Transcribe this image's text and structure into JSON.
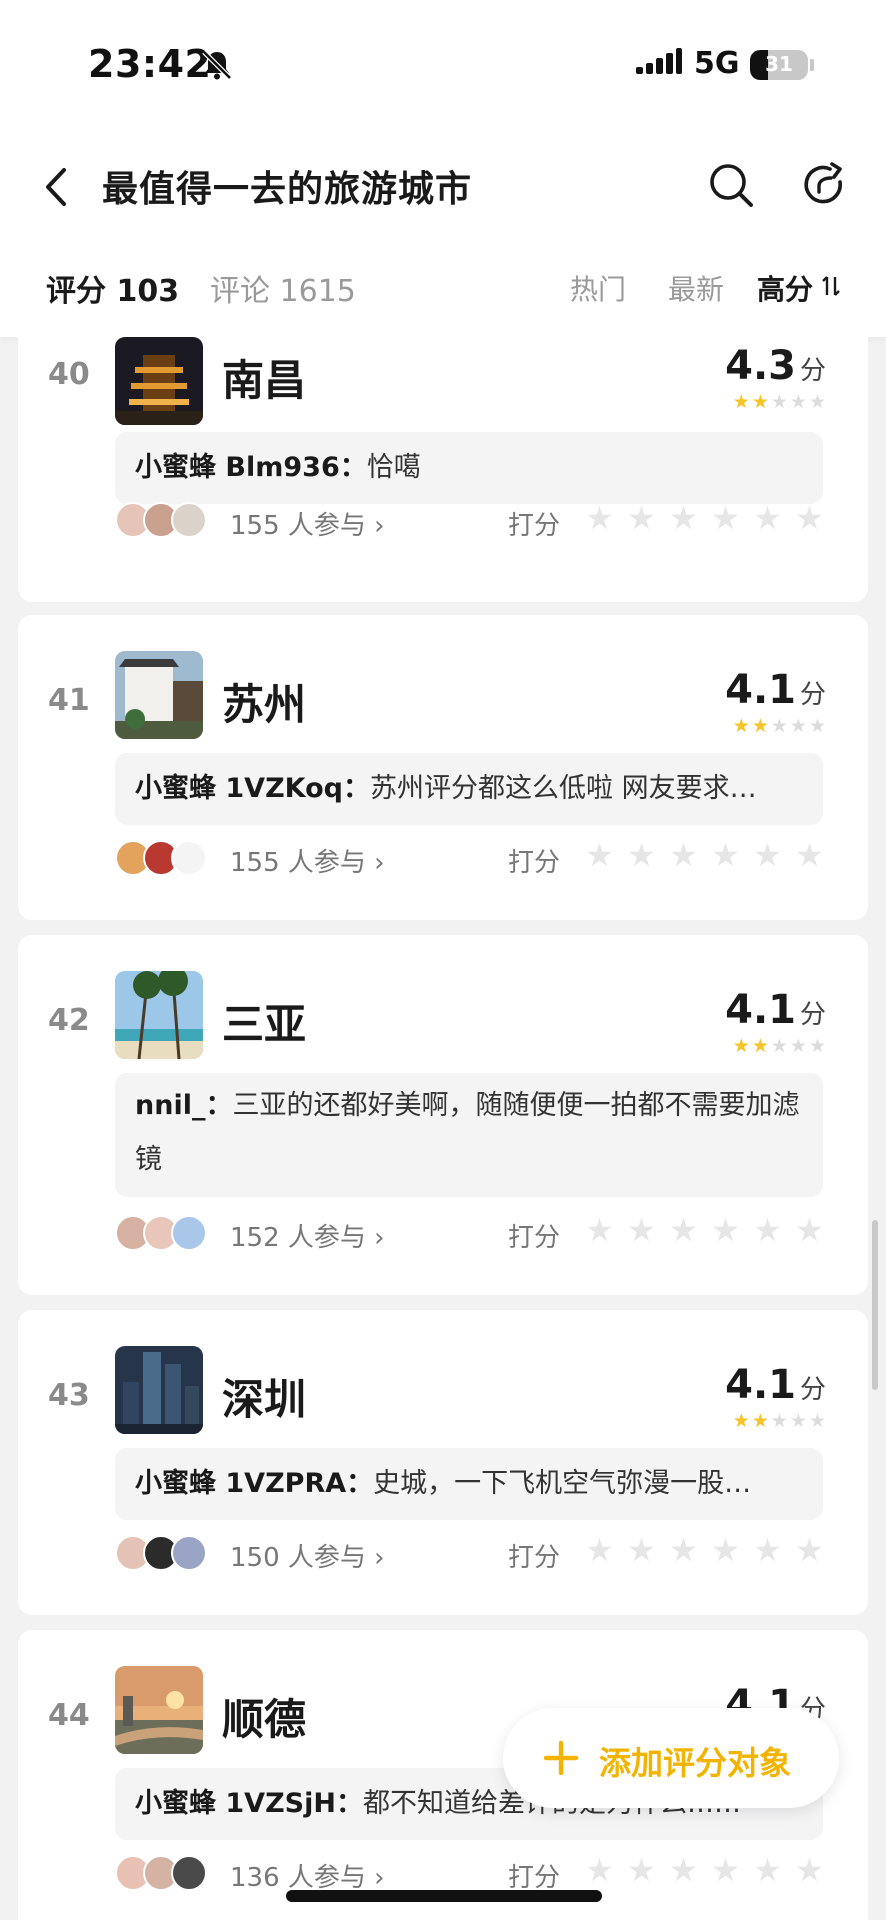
{
  "status_bar": {
    "time": "23:42",
    "network": "5G",
    "battery": "31",
    "battery_level_percent": 31
  },
  "header": {
    "title": "最值得一去的旅游城市",
    "icons": [
      "back-icon",
      "search-icon",
      "share-icon"
    ]
  },
  "tabs": {
    "ratings": "评分 103",
    "comments": "评论 1615"
  },
  "sort": {
    "hot": "热门",
    "new": "最新",
    "high": "高分",
    "active": "高分"
  },
  "common": {
    "score_unit": "分",
    "rate_label": "打分"
  },
  "colors": {
    "star_active": "#f6c427",
    "fab_text": "#f2b400",
    "card_bg": "#ffffff",
    "page_bg": "#f2f2f3"
  },
  "items": [
    {
      "rank": "40",
      "name": "南昌",
      "score": "4.3",
      "stars_filled": 2,
      "user": "小蜜蜂 Blm936：",
      "text": "恰噶",
      "participants": "155 人参与"
    },
    {
      "rank": "41",
      "name": "苏州",
      "score": "4.1",
      "stars_filled": 2,
      "user": "小蜜蜂 1VZKoq：",
      "text": "苏州评分都这么低啦 网友要求…",
      "participants": "155 人参与"
    },
    {
      "rank": "42",
      "name": "三亚",
      "score": "4.1",
      "stars_filled": 2,
      "user": "nnil_：",
      "text": "三亚的还都好美啊，随随便便一拍都不需要加滤镜",
      "participants": "152 人参与"
    },
    {
      "rank": "43",
      "name": "深圳",
      "score": "4.1",
      "stars_filled": 2,
      "user": "小蜜蜂 1VZPRA：",
      "text": "史城，一下飞机空气弥漫一股…",
      "participants": "150 人参与"
    },
    {
      "rank": "44",
      "name": "顺德",
      "score": "4.1",
      "stars_filled": 2,
      "user": "小蜜蜂 1VZSjH：",
      "text": "都不知道给差评的是为什么……",
      "participants": "136 人参与"
    }
  ],
  "fab": {
    "label": "添加评分对象"
  }
}
